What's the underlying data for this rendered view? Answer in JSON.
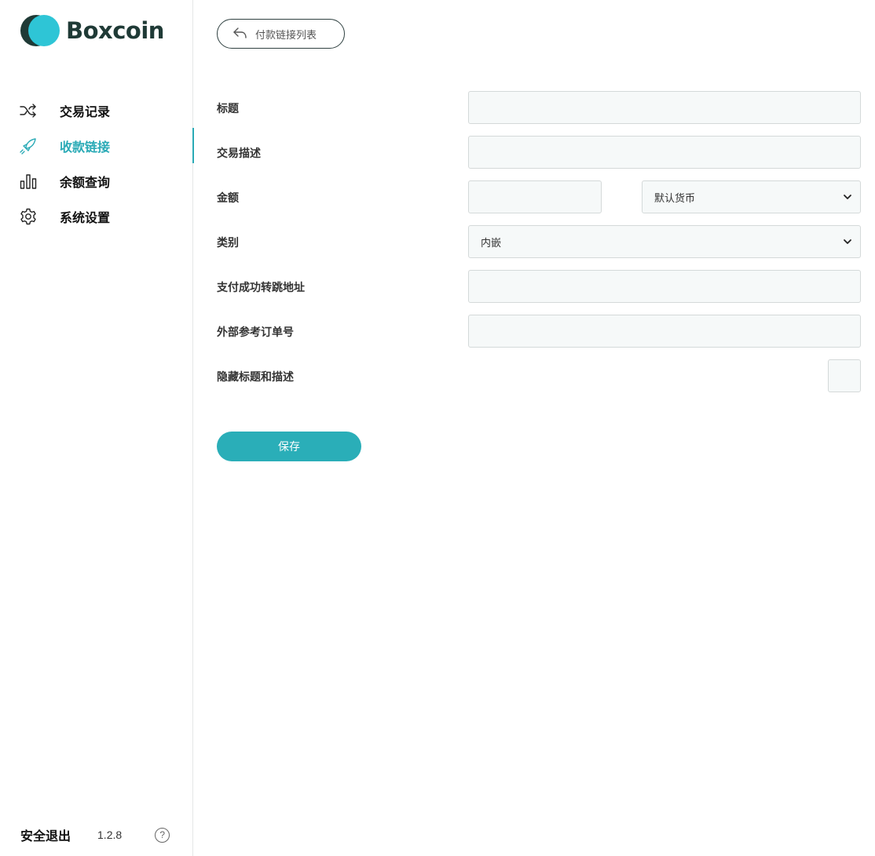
{
  "brand": {
    "name": "Boxcoin"
  },
  "sidebar": {
    "items": [
      {
        "label": "交易记录",
        "icon": "shuffle-icon"
      },
      {
        "label": "收款链接",
        "icon": "rocket-icon",
        "active": true
      },
      {
        "label": "余额查询",
        "icon": "bar-chart-icon"
      },
      {
        "label": "系统设置",
        "icon": "gear-icon"
      }
    ],
    "active_color": "#2aaab6"
  },
  "footer": {
    "logout_label": "安全退出",
    "version": "1.2.8",
    "help_icon": "question-icon",
    "help_symbol": "?"
  },
  "header": {
    "back_label": "付款链接列表",
    "back_icon": "reply-arrow-icon"
  },
  "form": {
    "title_label": "标题",
    "title_value": "",
    "description_label": "交易描述",
    "description_value": "",
    "amount_label": "金额",
    "amount_value": "",
    "currency_selected": "默认货币",
    "category_label": "类别",
    "category_selected": "内嵌",
    "redirect_label": "支付成功转跳地址",
    "redirect_value": "",
    "reference_label": "外部参考订单号",
    "reference_value": "",
    "hide_label": "隐藏标题和描述",
    "hide_checked": false
  },
  "actions": {
    "save_label": "保存"
  },
  "colors": {
    "accent": "#2aaeb8",
    "logo_dark": "#1f3a36",
    "logo_light": "#2ec5d6"
  }
}
